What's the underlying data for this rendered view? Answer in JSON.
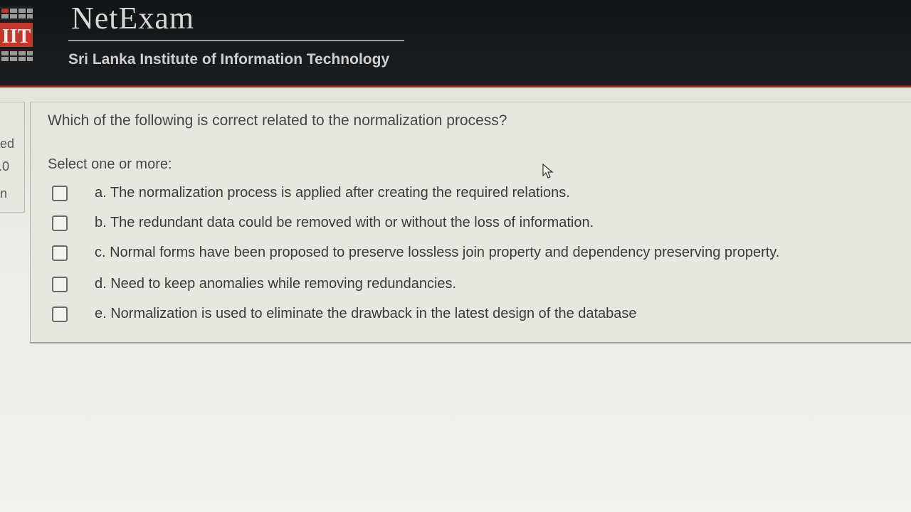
{
  "header": {
    "brand": "NetExam",
    "institute": "Sri Lanka Institute of Information Technology"
  },
  "side_panel": {
    "fragments": [
      "ed",
      ".0",
      "n"
    ]
  },
  "question": {
    "text": "Which of the following is correct related to the normalization process?",
    "prompt": "Select one or more:",
    "options": [
      {
        "label": "a. The normalization process is applied after creating the required relations.",
        "checked": false
      },
      {
        "label": "b. The redundant data could be removed with or without the loss of information.",
        "checked": false
      },
      {
        "label": "c. Normal forms have been proposed to preserve lossless join property and dependency preserving property.",
        "checked": false
      },
      {
        "label": "d. Need to keep anomalies while removing redundancies.",
        "checked": false
      },
      {
        "label": "e. Normalization is used to eliminate the drawback in the latest design of the database",
        "checked": false
      }
    ]
  },
  "colors": {
    "header_bg": "#15191a",
    "accent_line": "#8a2a1c",
    "page_bg": "#e9e9e4"
  }
}
